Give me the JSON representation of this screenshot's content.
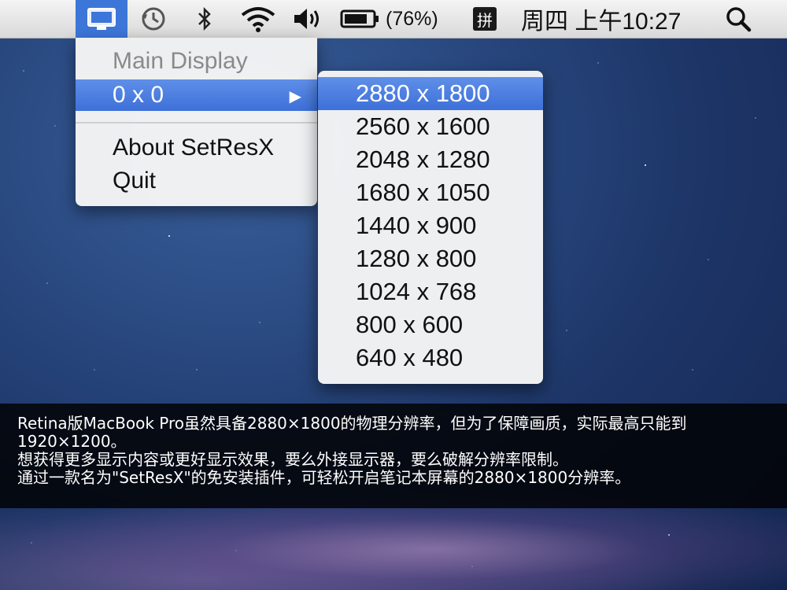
{
  "menubar": {
    "battery_percent": "(76%)",
    "input_method": "拼",
    "clock": "周四 上午10:27",
    "icons": [
      "display-icon",
      "time-machine-icon",
      "bluetooth-icon",
      "wifi-icon",
      "volume-icon",
      "battery-icon",
      "search-icon"
    ]
  },
  "menu": {
    "header": "Main Display",
    "selected": "0 x 0",
    "about": "About SetResX",
    "quit": "Quit"
  },
  "submenu": {
    "items": [
      "2880 x 1800",
      "2560 x 1600",
      "2048 x 1280",
      "1680 x 1050",
      "1440 x 900",
      "1280 x 800",
      "1024 x 768",
      "800 x 600",
      "640 x 480"
    ],
    "active_index": 0
  },
  "caption": {
    "line1": "Retina版MacBook Pro虽然具备2880×1800的物理分辨率，但为了保障画质，实际最高只能到1920×1200。",
    "line2": "想获得更多显示内容或更好显示效果，要么外接显示器，要么破解分辨率限制。",
    "line3": "通过一款名为\"SetResX\"的免安装插件，可轻松开启笔记本屏幕的2880×1800分辨率。"
  },
  "colors": {
    "menu_highlight": "#3d70d9",
    "menubar_bg": "#e6e6e6"
  }
}
